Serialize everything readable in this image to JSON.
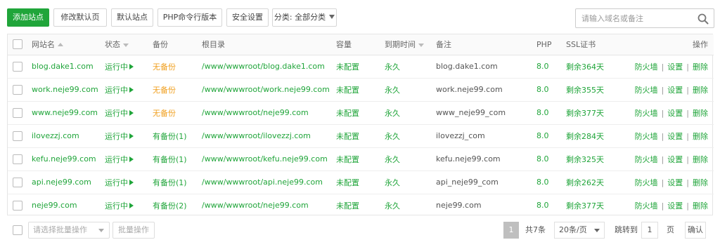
{
  "toolbar": {
    "add_site": "添加站点",
    "edit_default_page": "修改默认页",
    "default_site": "默认站点",
    "php_cli_version": "PHP命令行版本",
    "security_settings": "安全设置",
    "category_label": "分类: 全部分类",
    "search_placeholder": "请输入域名或备注",
    "search_icon": "search-icon"
  },
  "table": {
    "columns": {
      "site_name": "网站名",
      "status": "状态",
      "backup": "备份",
      "root_dir": "根目录",
      "capacity": "容量",
      "expiry": "到期时间",
      "remark": "备注",
      "php": "PHP",
      "ssl": "SSL证书",
      "actions": "操作"
    },
    "rows": [
      {
        "site": "blog.dake1.com",
        "status": "运行中",
        "backup": "无备份",
        "backup_state": "none",
        "root": "/www/wwwroot/blog.dake1.com",
        "capacity": "未配置",
        "expiry": "永久",
        "remark": "blog.dake1.com",
        "php": "8.0",
        "ssl": "剩余364天",
        "op_firewall": "防火墙",
        "op_settings": "设置",
        "op_delete": "删除"
      },
      {
        "site": "work.neje99.com",
        "status": "运行中",
        "backup": "无备份",
        "backup_state": "none",
        "root": "/www/wwwroot/work.neje99.com",
        "capacity": "未配置",
        "expiry": "永久",
        "remark": "work.neje99.com",
        "php": "8.0",
        "ssl": "剩余355天",
        "op_firewall": "防火墙",
        "op_settings": "设置",
        "op_delete": "删除"
      },
      {
        "site": "www.neje99.com",
        "status": "运行中",
        "backup": "无备份",
        "backup_state": "none",
        "root": "/www/wwwroot/neje99.com",
        "capacity": "未配置",
        "expiry": "永久",
        "remark": "www_neje99_com",
        "php": "8.0",
        "ssl": "剩余377天",
        "op_firewall": "防火墙",
        "op_settings": "设置",
        "op_delete": "删除"
      },
      {
        "site": "ilovezzj.com",
        "status": "运行中",
        "backup": "有备份(1)",
        "backup_state": "some",
        "root": "/www/wwwroot/ilovezzj.com",
        "capacity": "未配置",
        "expiry": "永久",
        "remark": "ilovezzj_com",
        "php": "8.0",
        "ssl": "剩余284天",
        "op_firewall": "防火墙",
        "op_settings": "设置",
        "op_delete": "删除"
      },
      {
        "site": "kefu.neje99.com",
        "status": "运行中",
        "backup": "有备份(1)",
        "backup_state": "some",
        "root": "/www/wwwroot/kefu.neje99.com",
        "capacity": "未配置",
        "expiry": "永久",
        "remark": "kefu.neje99.com",
        "php": "8.0",
        "ssl": "剩余325天",
        "op_firewall": "防火墙",
        "op_settings": "设置",
        "op_delete": "删除"
      },
      {
        "site": "api.neje99.com",
        "status": "运行中",
        "backup": "有备份(1)",
        "backup_state": "some",
        "root": "/www/wwwroot/api.neje99.com",
        "capacity": "未配置",
        "expiry": "永久",
        "remark": "api_neje99_com",
        "php": "8.0",
        "ssl": "剩余262天",
        "op_firewall": "防火墙",
        "op_settings": "设置",
        "op_delete": "删除"
      },
      {
        "site": "neje99.com",
        "status": "运行中",
        "backup": "有备份(2)",
        "backup_state": "some",
        "root": "/www/wwwroot/neje99.com",
        "capacity": "未配置",
        "expiry": "永久",
        "remark": "neje99.com",
        "php": "8.0",
        "ssl": "剩余377天",
        "op_firewall": "防火墙",
        "op_settings": "设置",
        "op_delete": "删除"
      }
    ],
    "separator": "|"
  },
  "bottom": {
    "batch_placeholder": "请选择批量操作",
    "batch_button": "批量操作",
    "pager": {
      "current_page": "1",
      "total": "共7条",
      "per_page": "20条/页",
      "jump_label": "跳转到",
      "jump_value": "1",
      "page_unit": "页",
      "confirm": "确认"
    }
  },
  "colors": {
    "accent_green": "#20a53a",
    "warn_orange": "#f0a020"
  }
}
